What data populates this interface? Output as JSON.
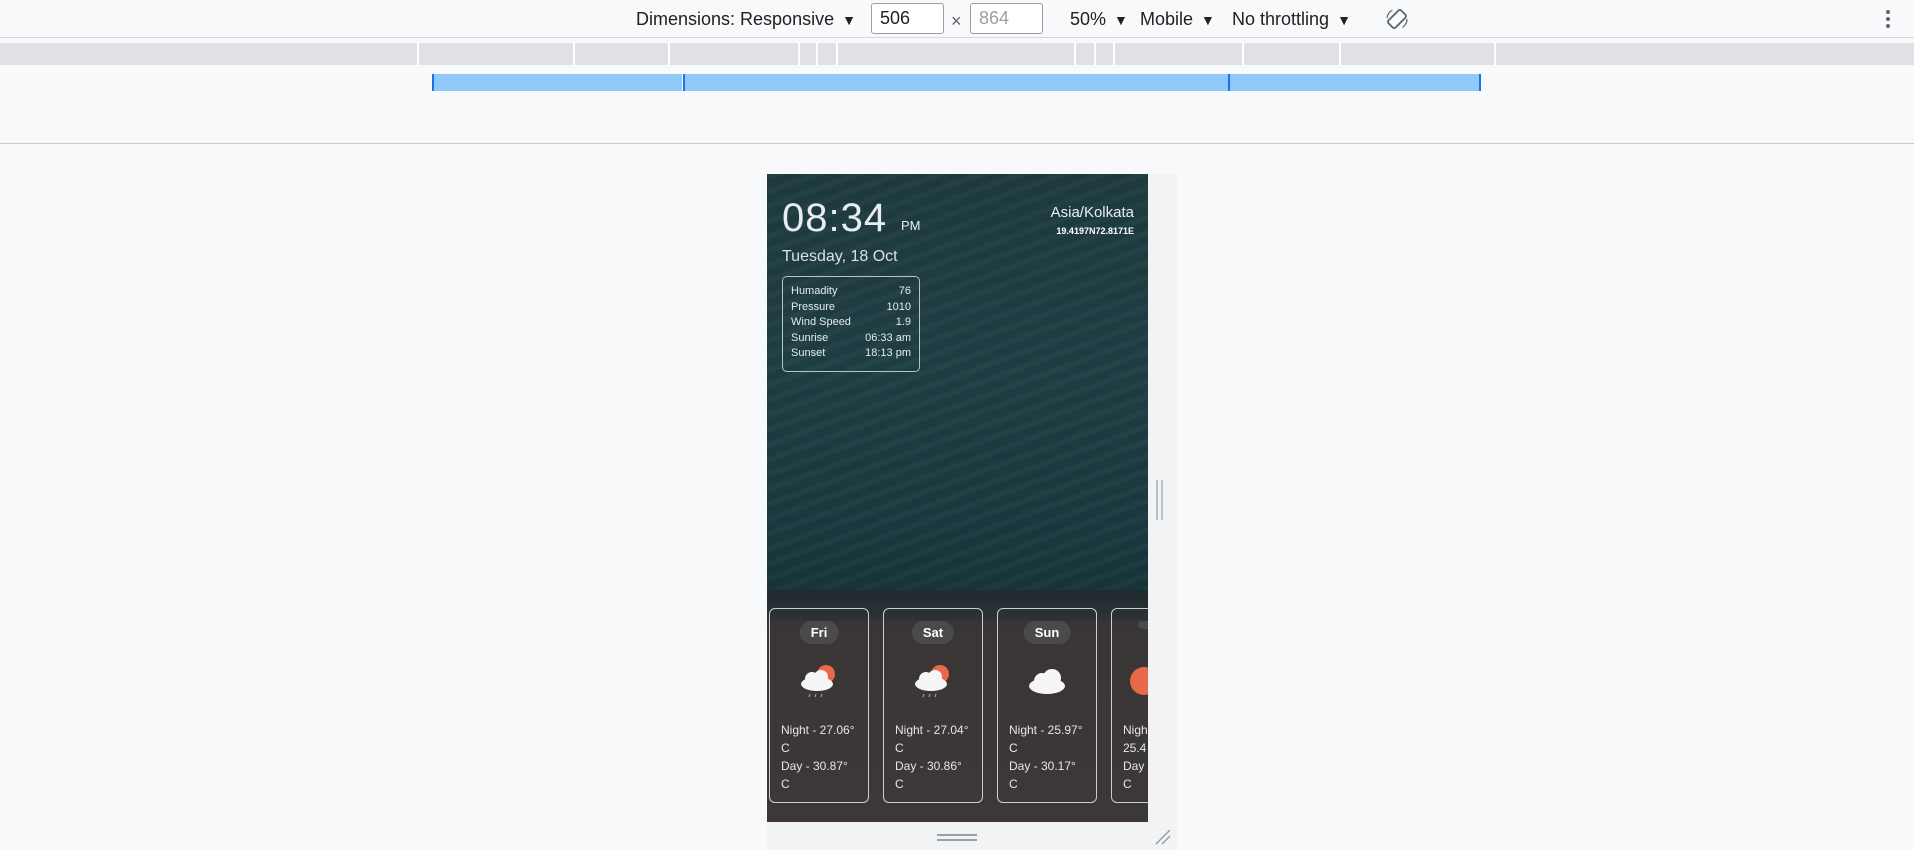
{
  "devtools": {
    "dimensions_label": "Dimensions: Responsive",
    "width_value": "506",
    "height_value": "864",
    "times": "×",
    "zoom": "50%",
    "device_type": "Mobile",
    "throttling": "No throttling",
    "caret": "▼"
  },
  "weather": {
    "time": "08:34",
    "ampm": "PM",
    "date": "Tuesday, 18 Oct",
    "timezone": "Asia/Kolkata",
    "coordinates": "19.4197N72.8171E",
    "stats": [
      {
        "label": "Humadity",
        "value": "76"
      },
      {
        "label": "Pressure",
        "value": "1010"
      },
      {
        "label": "Wind Speed",
        "value": "1.9"
      },
      {
        "label": "Sunrise",
        "value": "06:33 am"
      },
      {
        "label": "Sunset",
        "value": "18:13 pm"
      }
    ],
    "forecast": [
      {
        "day": "Fri",
        "night": "Night - 27.06°",
        "night_unit": "C",
        "day_temp": "Day - 30.87°",
        "day_unit": "C",
        "icon": "cloud-sun-rain-icon"
      },
      {
        "day": "Sat",
        "night": "Night - 27.04°",
        "night_unit": "C",
        "day_temp": "Day - 30.86°",
        "day_unit": "C",
        "icon": "cloud-sun-rain-icon"
      },
      {
        "day": "Sun",
        "night": "Night - 25.97°",
        "night_unit": "C",
        "day_temp": "Day - 30.17°",
        "day_unit": "C",
        "icon": "cloud-icon"
      },
      {
        "day": "",
        "night": "Nigh",
        "night_unit": "25.4",
        "day_temp": "Day",
        "day_unit": "C",
        "icon": "sun-icon"
      }
    ]
  },
  "colors": {
    "accent_blue": "#90c8f8",
    "sun_orange": "#e8684a"
  }
}
